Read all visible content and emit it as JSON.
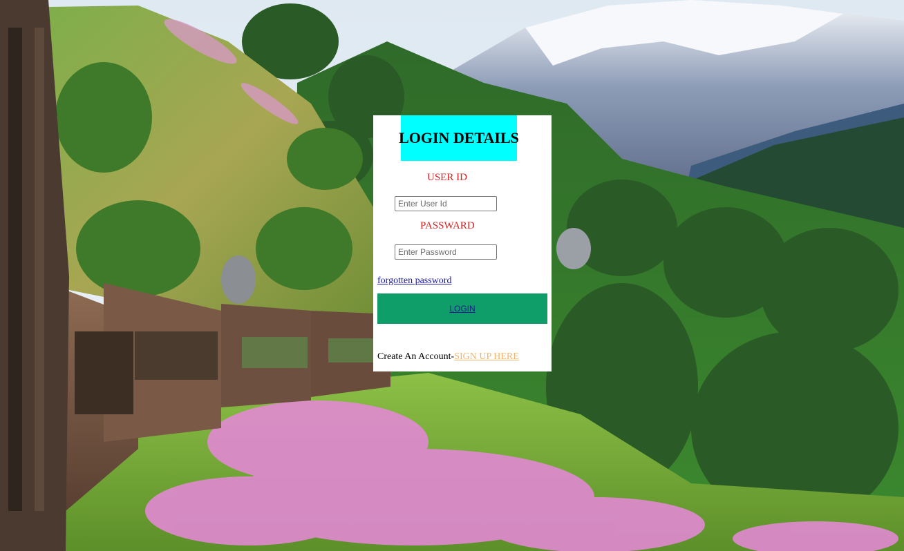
{
  "login": {
    "title": "LOGIN DETAILS",
    "user_label": "USER ID",
    "user_placeholder": "Enter User Id",
    "password_label": "PASSWARD",
    "password_placeholder": "Enter Password",
    "forgot_link": "forgotten password",
    "login_button": "LOGIN",
    "create_account_text": "Create An Account-",
    "signup_link": "SIGN UP HERE"
  },
  "colors": {
    "title_background": "#00ffff",
    "label_color": "#d22222",
    "login_button_background": "#0f9d6a",
    "signup_link_color": "#f2b46a"
  }
}
